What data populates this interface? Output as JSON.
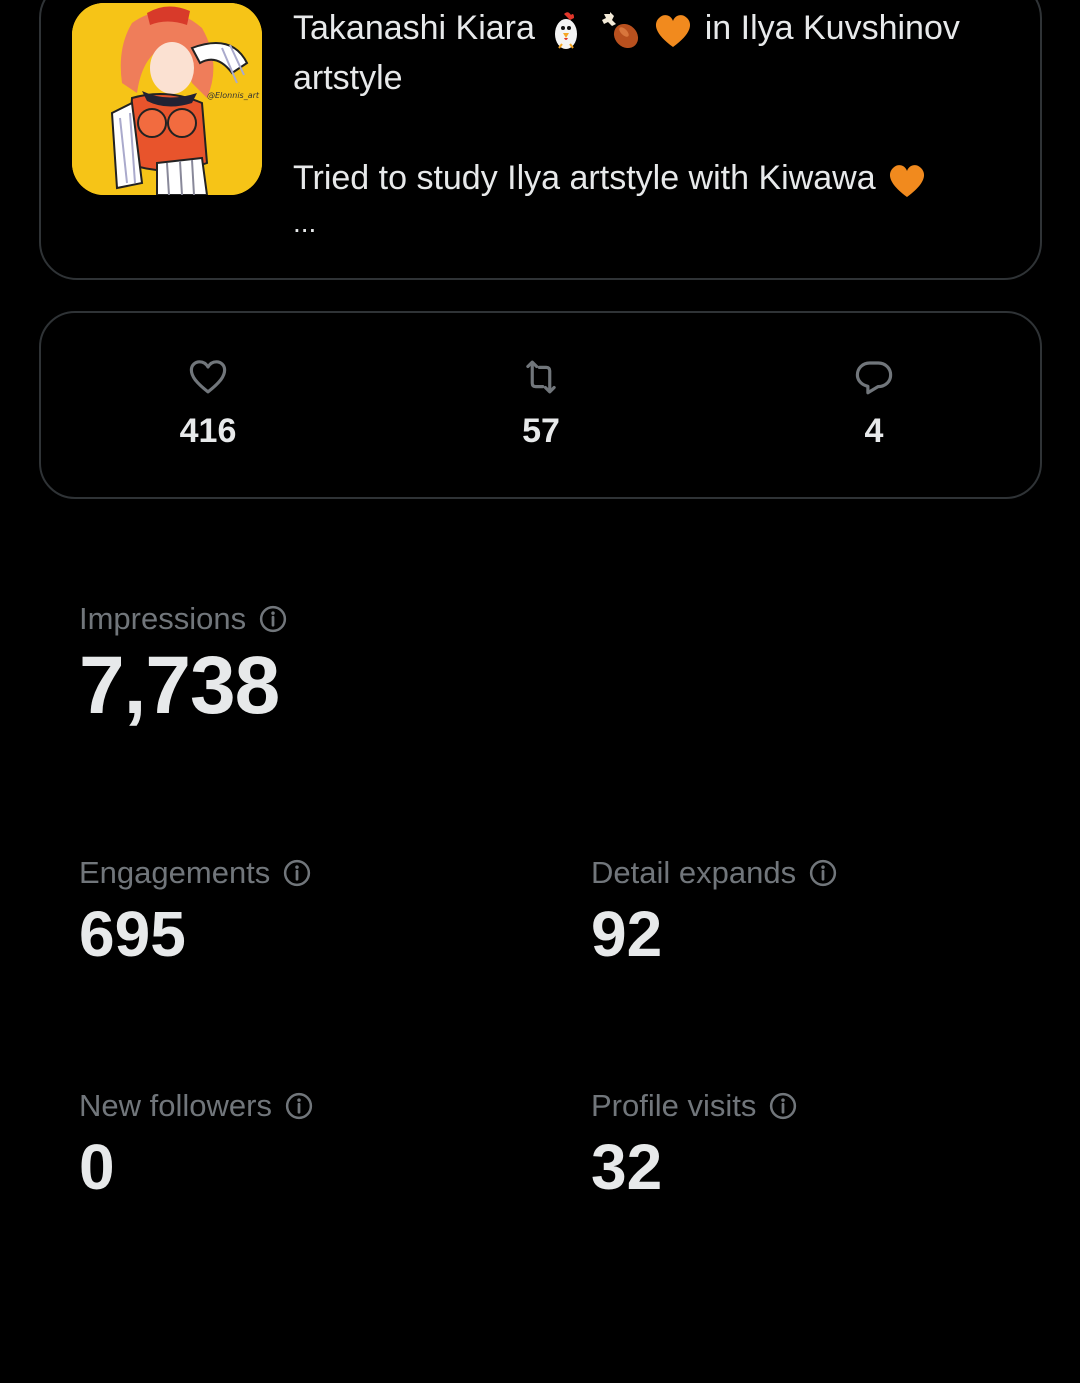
{
  "post": {
    "title_part1": "Takanashi Kiara",
    "title_part2": "in Ilya Kuvshinov",
    "title_part3": "artstyle",
    "body": "Tried to study Ilya artstyle with Kiwawa",
    "ellipsis": "...",
    "emojis": [
      "chicken-emoji",
      "drumstick-emoji",
      "orange-heart-emoji"
    ]
  },
  "engagement_stats": {
    "likes": "416",
    "reposts": "57",
    "replies": "4"
  },
  "metrics": {
    "impressions": {
      "label": "Impressions",
      "value": "7,738"
    },
    "engagements": {
      "label": "Engagements",
      "value": "695"
    },
    "detail_expands": {
      "label": "Detail expands",
      "value": "92"
    },
    "new_followers": {
      "label": "New followers",
      "value": "0"
    },
    "profile_visits": {
      "label": "Profile visits",
      "value": "32"
    }
  },
  "colors": {
    "background": "#000000",
    "primary_text": "#e7e9ea",
    "secondary_text": "#71767b",
    "border": "#2f3336",
    "thumbnail_bg": "#f6c417"
  }
}
